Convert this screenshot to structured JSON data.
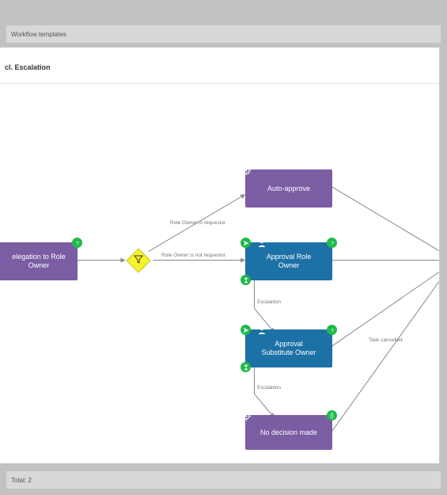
{
  "header": {
    "workflow_templates": "Workflow templates"
  },
  "footer": {
    "total": "Total: 2"
  },
  "panel": {
    "title": "cl. Escalation"
  },
  "nodes": {
    "delegation": {
      "label": "elegation to Role\nOwner"
    },
    "auto_approve": {
      "label": "Auto-approve"
    },
    "approval_role": {
      "label": "Approval Role\nOwner"
    },
    "approval_sub": {
      "label": "Approval\nSubstitute Owner"
    },
    "no_decision": {
      "label": "No decision made"
    }
  },
  "edges": {
    "is_requestor": {
      "label": "Role Owner is requestor"
    },
    "is_not_requestor": {
      "label": "Role Owner is not requestor"
    },
    "escalation1": {
      "label": "Escalation"
    },
    "escalation2": {
      "label": "Escalation"
    },
    "task_cancelled": {
      "label": "Task cancelled"
    }
  },
  "icons": {
    "gear": "gear-icon",
    "filter": "filter-icon",
    "question": "question-icon",
    "send": "send-icon",
    "person": "person-icon",
    "hourglass": "hourglass-icon",
    "braces": "braces-icon"
  }
}
